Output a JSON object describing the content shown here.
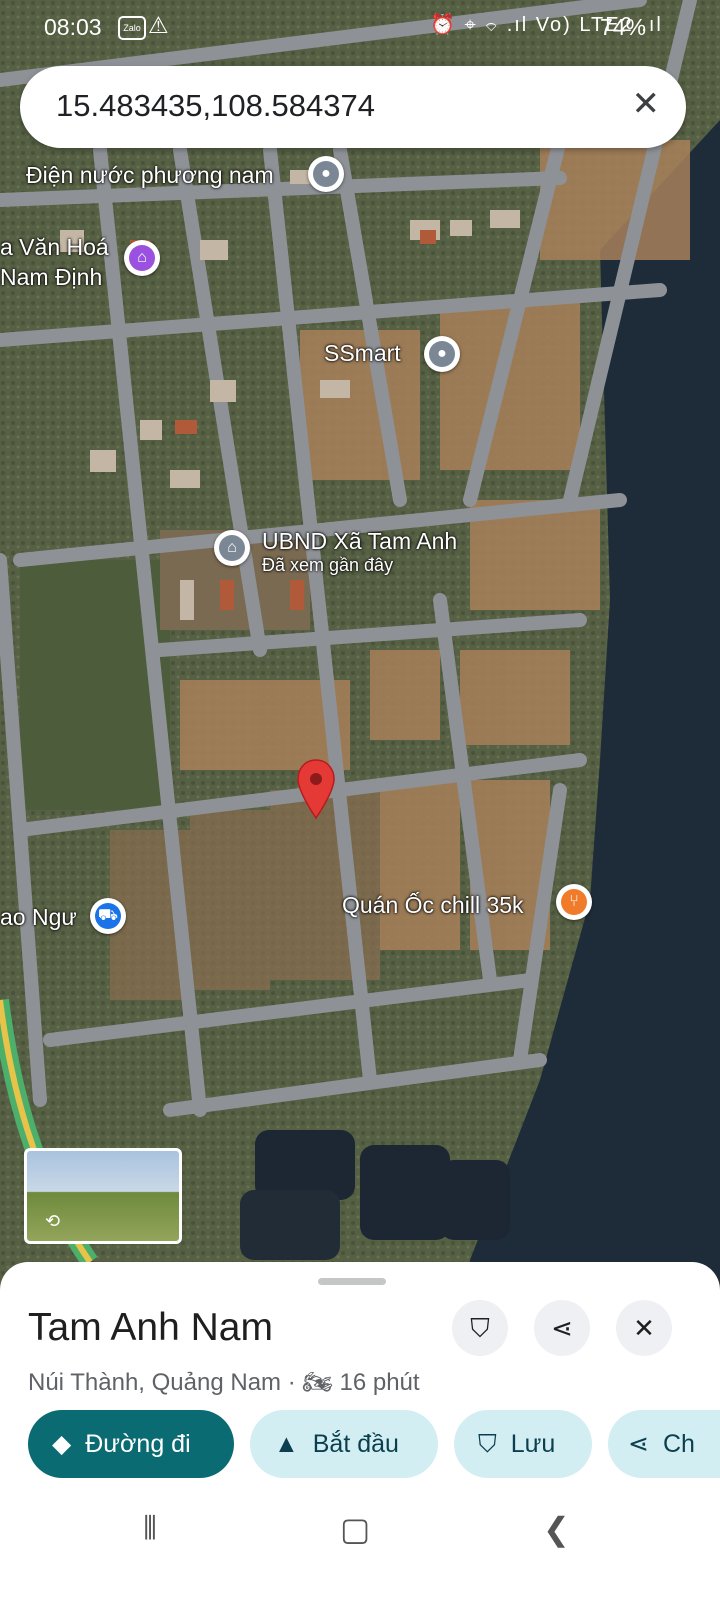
{
  "status_bar": {
    "time": "08:03",
    "zalo_label": "Zalo",
    "warning_icon": "warning-icon",
    "right_icons": "⏰ ⌖ ⌔ .ıl Vo) LTE2 .ıl",
    "battery": "74%"
  },
  "search": {
    "query": "15.483435,108.584374",
    "clear_icon": "close-icon"
  },
  "map": {
    "places": [
      {
        "label": "Điện nước phương nam",
        "icon": "place-icon"
      },
      {
        "label": "a Văn Hoá",
        "label2": "Nam Định",
        "icon": "landmark-icon"
      },
      {
        "label": "SSmart",
        "icon": "place-icon"
      },
      {
        "label": "UBND Xã Tam Anh",
        "sublabel": "Đã xem gần đây",
        "icon": "government-icon"
      },
      {
        "label": "Quán Ốc chill 35k",
        "icon": "restaurant-icon"
      },
      {
        "label": "ao Ngư",
        "icon": "shopping-cart-icon"
      }
    ],
    "selected_pin": "red-pin-icon"
  },
  "sheet": {
    "title": "Tam Anh Nam",
    "subtitle": "Núi Thành, Quảng Nam · ",
    "travel_time": "16 phút",
    "travel_icon": "motorbike-icon",
    "buttons": {
      "save_icon": "bookmark-icon",
      "share_icon": "share-icon",
      "close_icon": "close-icon"
    },
    "chips": [
      {
        "label": "Đường đi",
        "icon": "directions-icon"
      },
      {
        "label": "Bắt đầu",
        "icon": "navigation-icon"
      },
      {
        "label": "Lưu",
        "icon": "bookmark-icon"
      },
      {
        "label": "Ch",
        "icon": "share-icon"
      }
    ]
  },
  "nav": {
    "recent": "recent-apps-icon",
    "home": "home-icon",
    "back": "back-icon"
  },
  "colors": {
    "primary_chip": "#0b6b73",
    "chip_bg": "#d3eef3",
    "pin": "#e53935",
    "water": "#1e2c3a"
  }
}
